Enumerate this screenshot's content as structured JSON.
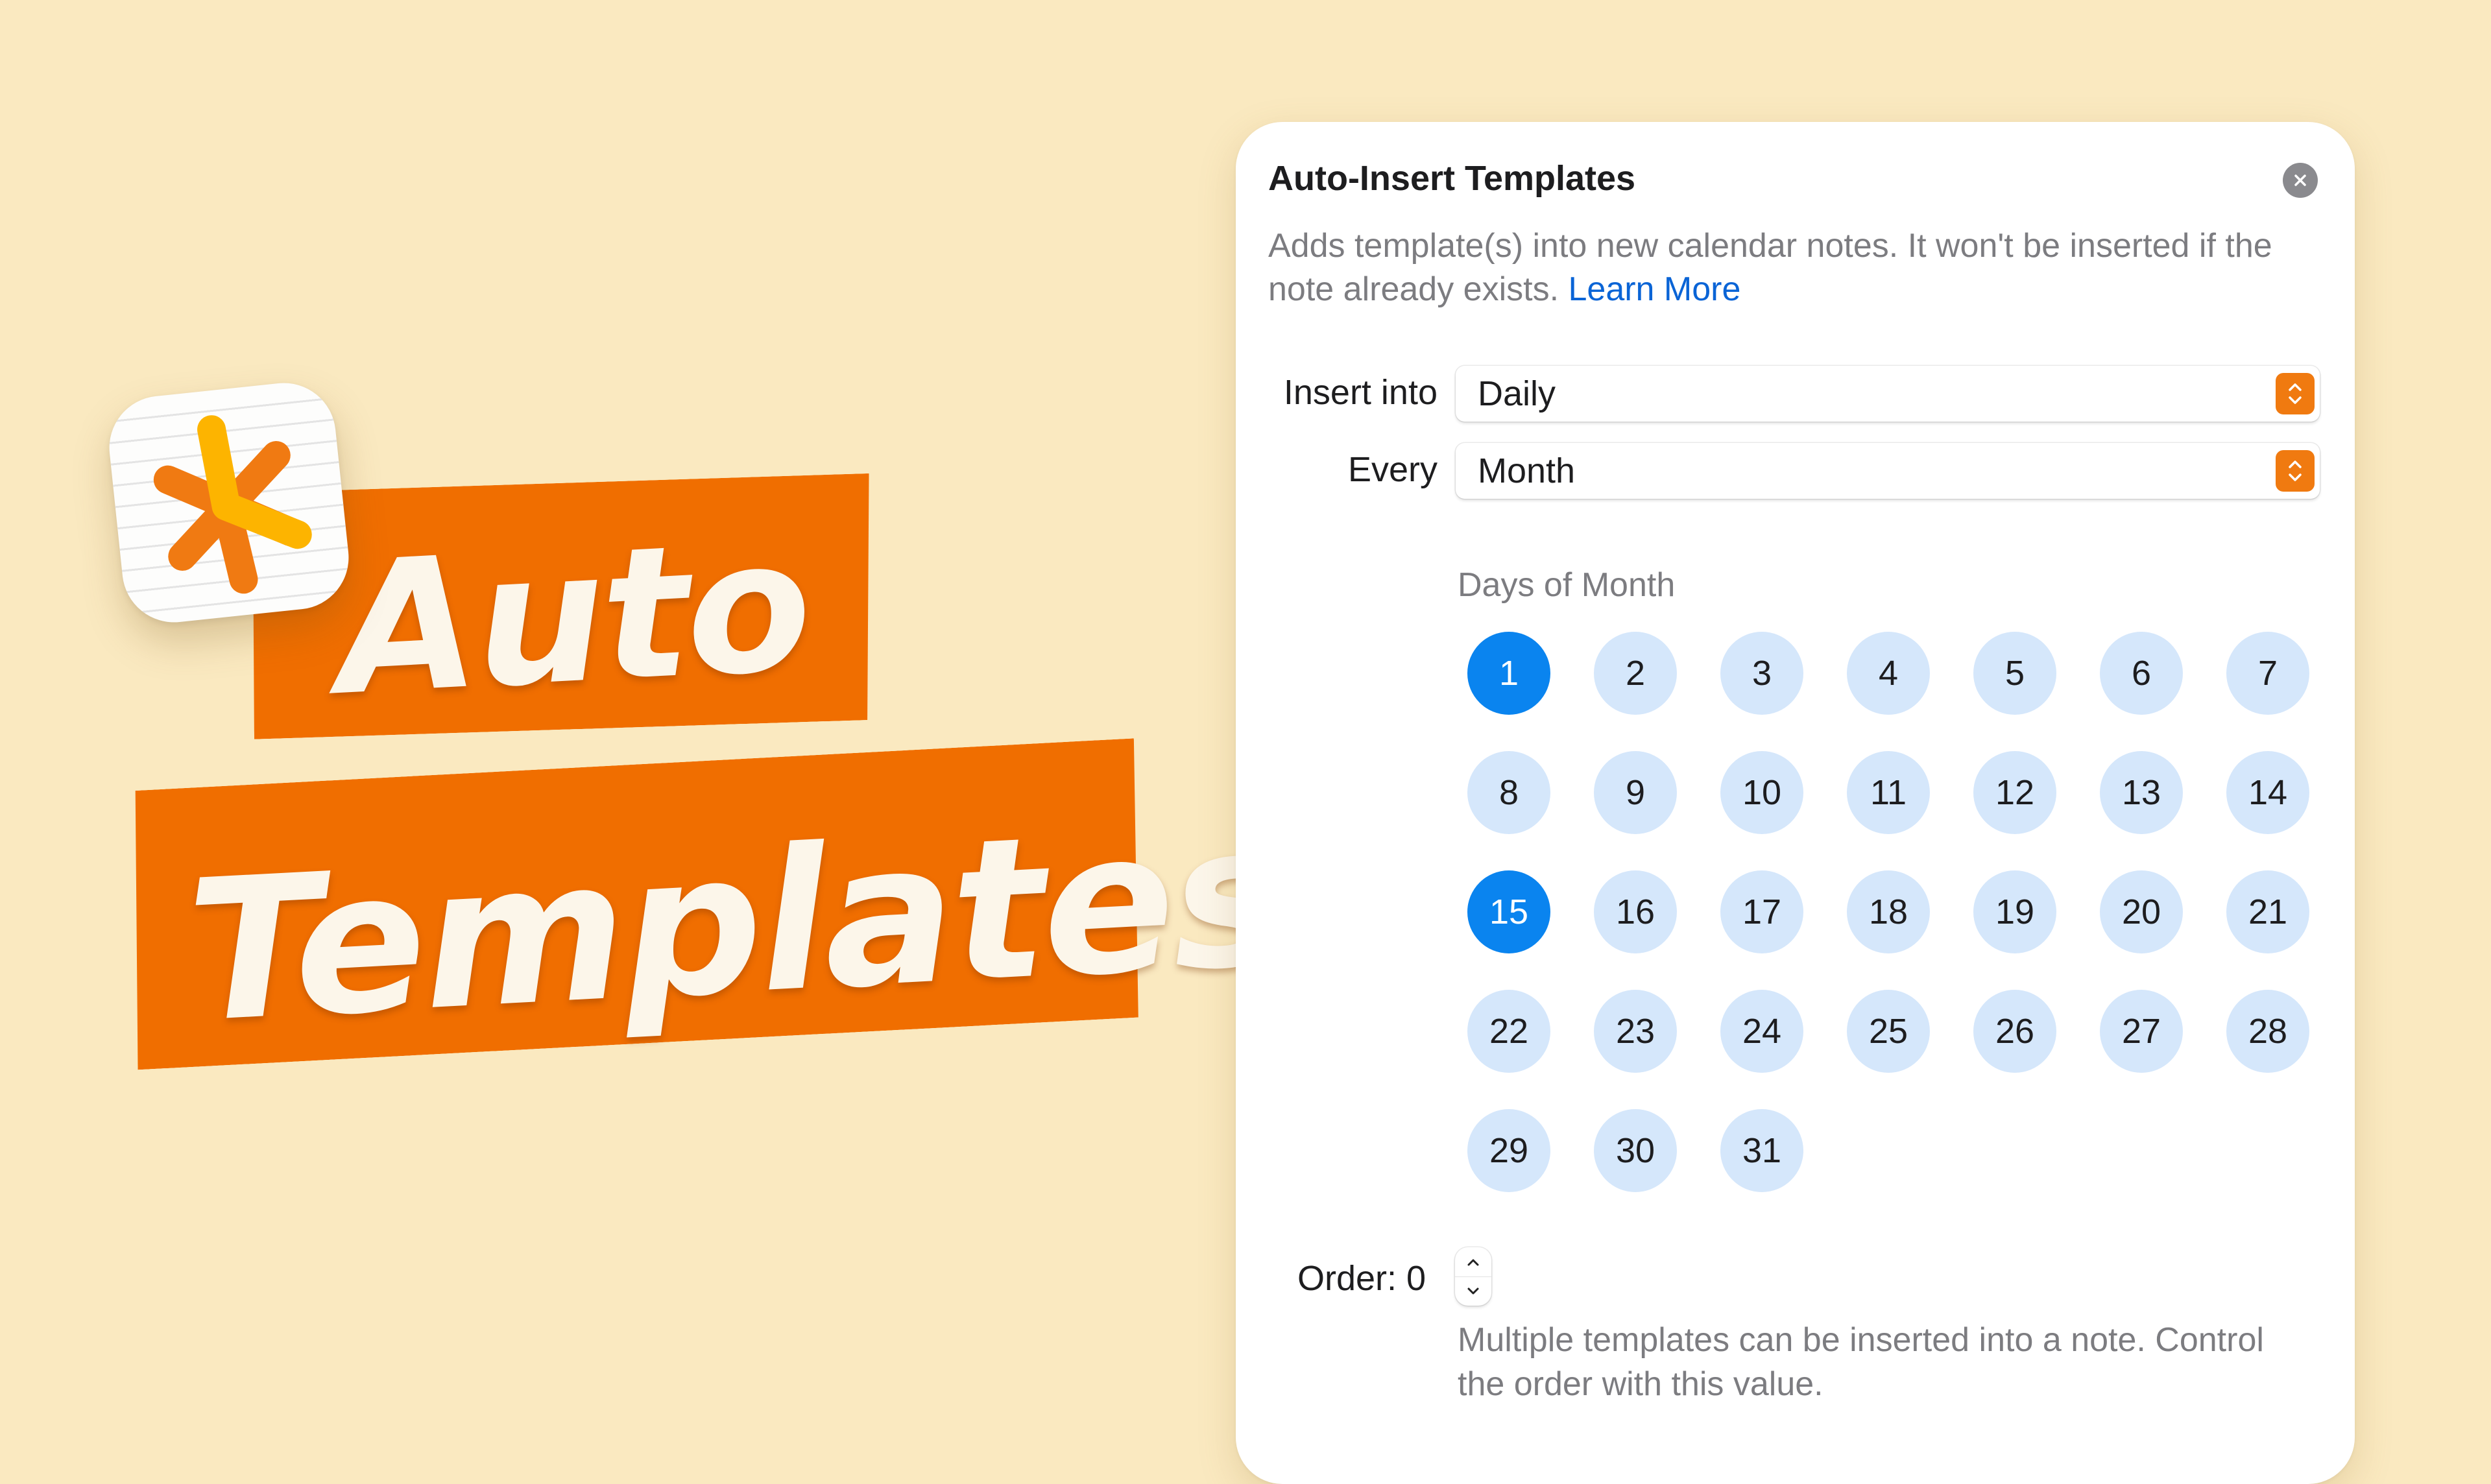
{
  "hero": {
    "line1": "Auto",
    "line2": "Templates",
    "banner_color": "#f06e00",
    "background_color": "#fae9c0"
  },
  "app_icon": {
    "name": "asterisk-app-icon"
  },
  "dialog": {
    "title": "Auto-Insert Templates",
    "close_icon": "close-icon",
    "description": "Adds template(s) into new calendar notes. It won't be inserted if the note already exists.",
    "learn_more": "Learn More",
    "insert_into": {
      "label": "Insert into",
      "value": "Daily"
    },
    "every": {
      "label": "Every",
      "value": "Month"
    },
    "days_label": "Days of Month",
    "days": [
      "1",
      "2",
      "3",
      "4",
      "5",
      "6",
      "7",
      "8",
      "9",
      "10",
      "11",
      "12",
      "13",
      "14",
      "15",
      "16",
      "17",
      "18",
      "19",
      "20",
      "21",
      "22",
      "23",
      "24",
      "25",
      "26",
      "27",
      "28",
      "29",
      "30",
      "31"
    ],
    "selected_days": [
      "1",
      "15"
    ],
    "order": {
      "label": "Order: 0",
      "value": 0
    },
    "order_help": "Multiple templates can be inserted into a note. Control the order with this value.",
    "accent_color": "#0a84ef",
    "stepper_color": "#f07a10"
  }
}
